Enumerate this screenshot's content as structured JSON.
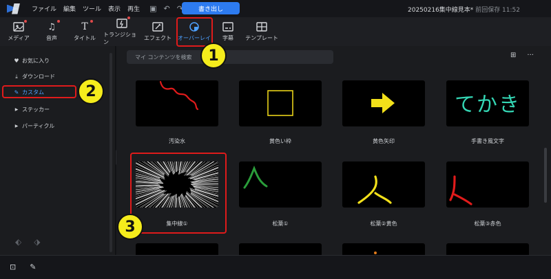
{
  "menu": {
    "items": [
      "ファイル",
      "編集",
      "ツール",
      "表示",
      "再生"
    ],
    "export_label": "書き出し",
    "project_name": "20250216集中線見本*",
    "save_status": "前回保存 11:52"
  },
  "tools": [
    {
      "label": "メディア",
      "icon": "media-icon"
    },
    {
      "label": "音声",
      "icon": "music-icon"
    },
    {
      "label": "タイトル",
      "icon": "title-icon"
    },
    {
      "label": "トランジション",
      "icon": "transition-icon"
    },
    {
      "label": "エフェクト",
      "icon": "effect-icon"
    },
    {
      "label": "オーバーレイ",
      "icon": "overlay-icon"
    },
    {
      "label": "字幕",
      "icon": "subtitle-icon"
    },
    {
      "label": "テンプレート",
      "icon": "template-icon"
    }
  ],
  "sidebar": {
    "items": [
      {
        "label": "お気に入り",
        "icon": "heart-icon"
      },
      {
        "label": "ダウンロード",
        "icon": "download-icon"
      },
      {
        "label": "カスタム",
        "icon": "pencil-icon"
      },
      {
        "label": "ステッカー",
        "icon": "caret-right-icon"
      },
      {
        "label": "パーティクル",
        "icon": "caret-right-icon"
      }
    ]
  },
  "search": {
    "placeholder": "マイ コンテンツを検索"
  },
  "grid": {
    "items": [
      {
        "label": "汚染水"
      },
      {
        "label": "黄色い枠"
      },
      {
        "label": "黄色矢印"
      },
      {
        "label": "手書き風文字",
        "thumb_text": "てかき"
      },
      {
        "label": "集中線①"
      },
      {
        "label": "松葉①"
      },
      {
        "label": "松葉②黄色"
      },
      {
        "label": "松葉③赤色"
      }
    ]
  },
  "callouts": [
    "1",
    "2",
    "3"
  ],
  "colors": {
    "accent": "#2d7bf0",
    "highlight": "#e01b1b",
    "callout": "#f5ec1c"
  }
}
